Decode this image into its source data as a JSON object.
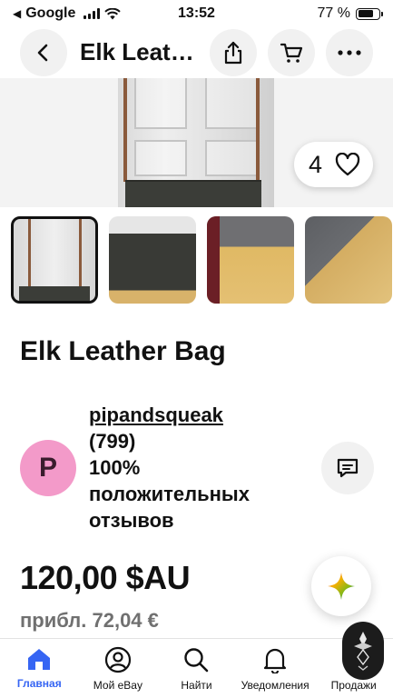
{
  "status_bar": {
    "back_app": "Google",
    "time": "13:52",
    "battery_percent": "77 %",
    "battery_level": 0.77
  },
  "header": {
    "title": "Elk Leather Bag",
    "back_icon": "chevron-left-icon",
    "share_icon": "share-icon",
    "cart_icon": "cart-icon",
    "more_icon": "more-horizontal-icon"
  },
  "gallery": {
    "watch_count": "4",
    "thumbnails": [
      "thumbnail-1",
      "thumbnail-2",
      "thumbnail-3",
      "thumbnail-4"
    ],
    "selected_index": 0
  },
  "item": {
    "title": "Elk Leather Bag"
  },
  "seller": {
    "avatar_initial": "P",
    "avatar_color": "#f39ac9",
    "name": "pipandsqueak",
    "feedback_count": "(799)",
    "positive_percent": "100%",
    "positive_label": "положительных отзывов"
  },
  "price": {
    "main": "120,00 $AU",
    "approx": "прибл. 72,04 €"
  },
  "bottom_nav": {
    "items": [
      {
        "label": "Главная",
        "icon": "home-icon"
      },
      {
        "label": "Мой eBay",
        "icon": "account-icon"
      },
      {
        "label": "Найти",
        "icon": "search-icon"
      },
      {
        "label": "Уведомления",
        "icon": "bell-icon"
      },
      {
        "label": "Продажи",
        "icon": "sell-icon"
      }
    ],
    "active_index": 0
  },
  "colors": {
    "accent": "#3665f3",
    "text": "#111111",
    "muted": "#707070"
  }
}
